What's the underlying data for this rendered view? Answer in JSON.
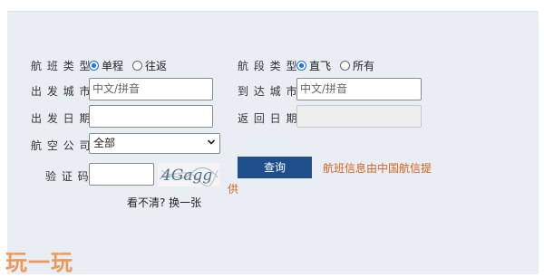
{
  "form": {
    "flight_type_label": "航 班 类 型:",
    "flight_type_options": [
      {
        "label": "单程",
        "selected": true
      },
      {
        "label": "往返",
        "selected": false
      }
    ],
    "segment_type_label": "航 段 类 型:",
    "segment_type_options": [
      {
        "label": "直飞",
        "selected": true
      },
      {
        "label": "所有",
        "selected": false
      }
    ],
    "departure_city_label": "出 发 城 市:",
    "departure_city_placeholder": "中文/拼音",
    "arrival_city_label": "到 达 城 市:",
    "arrival_city_placeholder": "中文/拼音",
    "departure_date_label": "出 发 日 期:",
    "departure_date_value": "",
    "return_date_label": "返 回 日 期:",
    "return_date_value": "",
    "airline_label": "航 空 公 司:",
    "airline_selected": "全部",
    "captcha_label": "验 证 码:",
    "captcha_value": "",
    "captcha_text": "4Gagg",
    "refresh_captcha_link": "看不清? 换一张",
    "search_button": "查询",
    "provider_note_main": "航班信息由中国航信提",
    "provider_note_tail": "供"
  },
  "watermark": "玩一玩",
  "colors": {
    "panel_bg": "#e9eef5",
    "button_bg": "#1f4e8c",
    "note_color": "#d9621e",
    "radio_accent": "#1a73e8",
    "watermark": "#f08a3c"
  }
}
